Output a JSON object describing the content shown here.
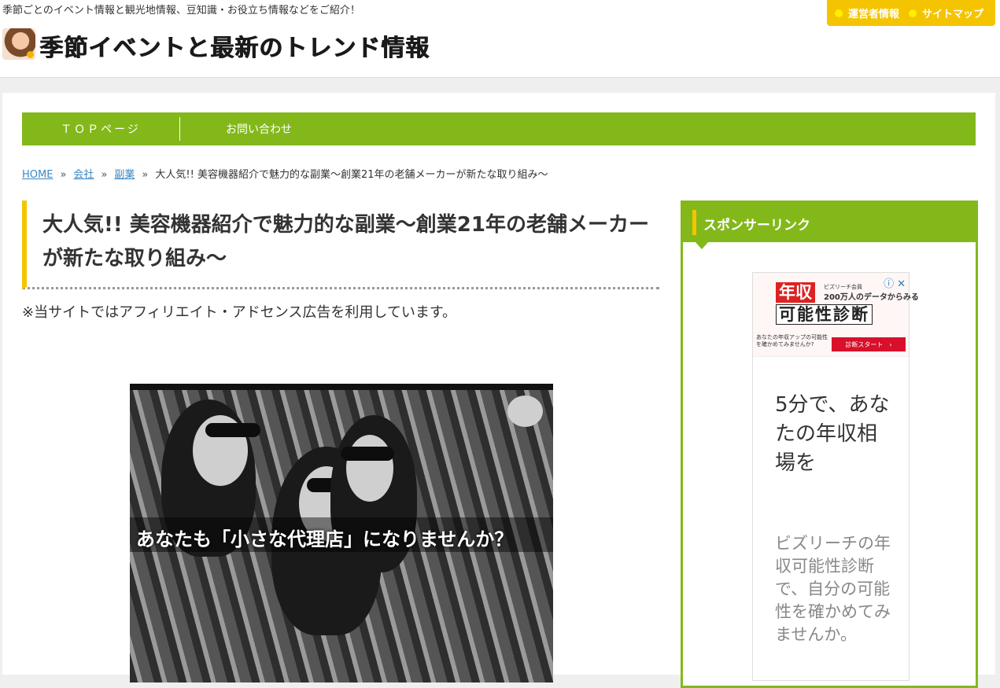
{
  "header": {
    "tagline": "季節ごとのイベント情報と観光地情報、豆知識・お役立ち情報などをご紹介！",
    "site_title": "季節イベントと最新のトレンド情報",
    "top_links": [
      "運営者情報",
      "サイトマップ"
    ]
  },
  "nav": {
    "items": [
      "ＴＯＰページ",
      "お問い合わせ"
    ]
  },
  "breadcrumb": {
    "home": "HOME",
    "crumb1": "会社",
    "crumb2": "副業",
    "current": "大人気!! 美容機器紹介で魅力的な副業～創業21年の老舗メーカーが新たな取り組み～",
    "separator": "»"
  },
  "article": {
    "title": "大人気!! 美容機器紹介で魅力的な副業～創業21年の老舗メーカーが新たな取り組み～",
    "note": "※当サイトではアフィリエイト・アドセンス広告を利用しています。",
    "hero_caption": "あなたも「小さな代理店」になりませんか？"
  },
  "sidebar": {
    "title": "スポンサーリンク",
    "ad": {
      "kanji_top": "年収",
      "kanji_bottom": "可能性診断",
      "small_line1": "ビズリーチ会員",
      "small_line2": "200万人のデータからみる",
      "sub_text": "あなたの年収アップの可能性を確かめてみませんか?",
      "cta": "診断スタート　›",
      "heading": "5分で、あなたの年収相場を",
      "body": "ビズリーチの年収可能性診断で、自分の可能性を確かめてみませんか。"
    }
  },
  "colors": {
    "accent_green": "#83b81a",
    "accent_yellow": "#f5c400",
    "link_blue": "#3b87c4",
    "ad_red": "#d8102b"
  }
}
